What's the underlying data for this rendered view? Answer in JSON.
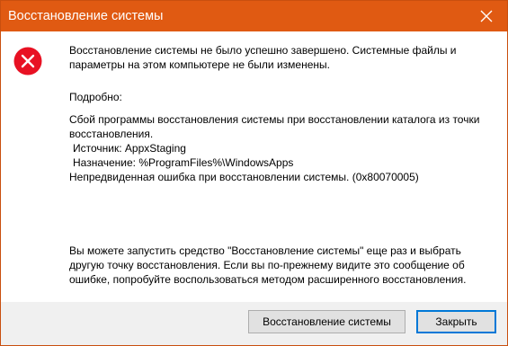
{
  "window": {
    "title": "Восстановление системы"
  },
  "icon": {
    "name": "error-icon",
    "color": "#e81123"
  },
  "accent_color": "#e05a12",
  "message": {
    "main": "Восстановление системы не было успешно завершено. Системные файлы и параметры на этом компьютере не были изменены.",
    "details_label": "Подробно:",
    "details_line1": "Сбой программы восстановления системы при восстановлении каталога из точки восстановления.",
    "source": "Источник: AppxStaging",
    "destination": "Назначение: %ProgramFiles%\\WindowsApps",
    "error": "Непредвиденная ошибка при восстановлении системы. (0x80070005)",
    "hint": "Вы можете запустить средство \"Восстановление системы\" еще раз и выбрать другую точку восстановления. Если вы по-прежнему видите это сообщение об ошибке, попробуйте воспользоваться методом расширенного восстановления."
  },
  "buttons": {
    "restore": "Восстановление системы",
    "close": "Закрыть"
  }
}
